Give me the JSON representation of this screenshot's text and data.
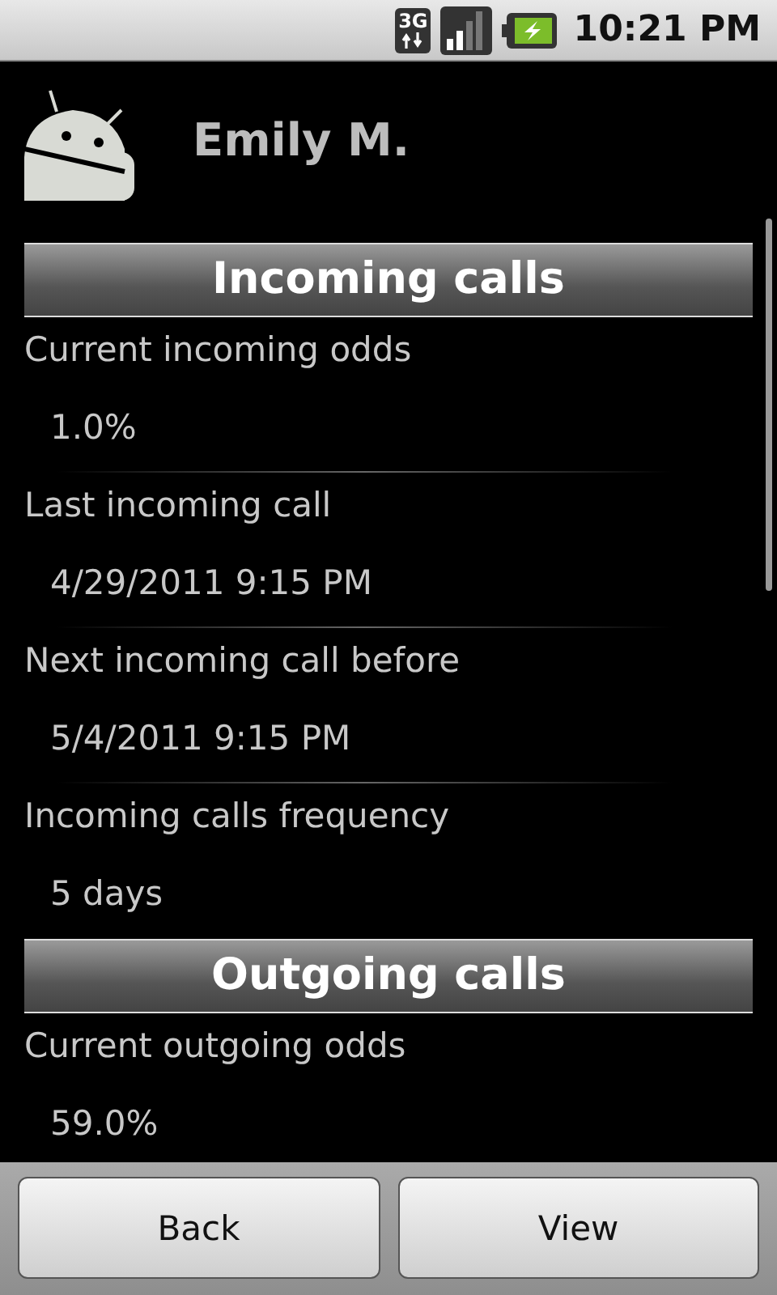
{
  "status_bar": {
    "network": "3G",
    "time": "10:21 PM"
  },
  "contact": {
    "name": "Emily M."
  },
  "sections": [
    {
      "title": "Incoming calls",
      "items": [
        {
          "label": "Current incoming odds",
          "value": "1.0%"
        },
        {
          "label": "Last incoming call",
          "value": "4/29/2011 9:15 PM"
        },
        {
          "label": "Next incoming call before",
          "value": "5/4/2011 9:15 PM"
        },
        {
          "label": "Incoming calls frequency",
          "value": "5 days"
        }
      ]
    },
    {
      "title": "Outgoing calls",
      "items": [
        {
          "label": "Current outgoing odds",
          "value": "59.0%"
        }
      ]
    }
  ],
  "buttons": [
    "Back",
    "View"
  ]
}
